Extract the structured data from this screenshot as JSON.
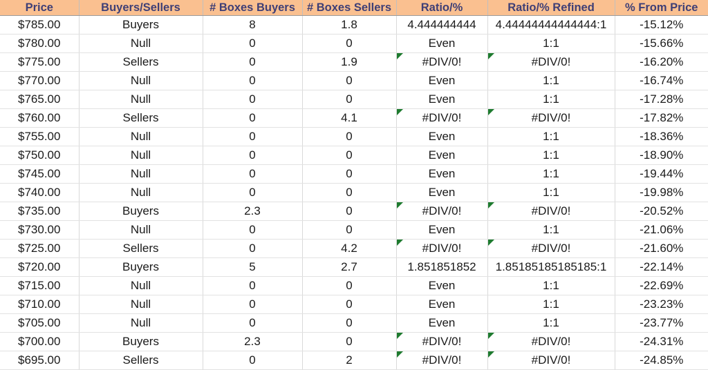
{
  "table": {
    "columns": [
      {
        "key": "price",
        "label": "Price"
      },
      {
        "key": "status",
        "label": "Buyers/Sellers"
      },
      {
        "key": "boxes_buy",
        "label": "# Boxes Buyers"
      },
      {
        "key": "boxes_sell",
        "label": "# Boxes Sellers"
      },
      {
        "key": "ratio",
        "label": "Ratio/%"
      },
      {
        "key": "ratio_ref",
        "label": "Ratio/% Refined"
      },
      {
        "key": "pct",
        "label": "% From Price"
      }
    ],
    "colors": {
      "header_bg": "#FAC090",
      "header_text": "#3F3F76",
      "buyers_bg": "#C6EFCE",
      "buyers_text": "#1E7B34",
      "sellers_bg": "#FFC7CE",
      "sellers_text": "#C00034",
      "null_bg": "#FFEB9C",
      "null_text": "#9C6500",
      "error_flag": "#1E7B2F",
      "grid_line": "#D9D9D9"
    },
    "rows": [
      {
        "price": "$785.00",
        "status": "Buyers",
        "status_kind": "buyers",
        "boxes_buy": "8",
        "boxes_sell": "1.8",
        "ratio": "4.444444444",
        "ratio_error": false,
        "ratio_ref": "4.44444444444444:1",
        "ratio_ref_error": false,
        "pct": "-15.12%"
      },
      {
        "price": "$780.00",
        "status": "Null",
        "status_kind": "null",
        "boxes_buy": "0",
        "boxes_sell": "0",
        "ratio": "Even",
        "ratio_error": false,
        "ratio_ref": "1:1",
        "ratio_ref_error": false,
        "pct": "-15.66%"
      },
      {
        "price": "$775.00",
        "status": "Sellers",
        "status_kind": "sellers",
        "boxes_buy": "0",
        "boxes_sell": "1.9",
        "ratio": "#DIV/0!",
        "ratio_error": true,
        "ratio_ref": "#DIV/0!",
        "ratio_ref_error": true,
        "pct": "-16.20%"
      },
      {
        "price": "$770.00",
        "status": "Null",
        "status_kind": "null",
        "boxes_buy": "0",
        "boxes_sell": "0",
        "ratio": "Even",
        "ratio_error": false,
        "ratio_ref": "1:1",
        "ratio_ref_error": false,
        "pct": "-16.74%"
      },
      {
        "price": "$765.00",
        "status": "Null",
        "status_kind": "null",
        "boxes_buy": "0",
        "boxes_sell": "0",
        "ratio": "Even",
        "ratio_error": false,
        "ratio_ref": "1:1",
        "ratio_ref_error": false,
        "pct": "-17.28%"
      },
      {
        "price": "$760.00",
        "status": "Sellers",
        "status_kind": "sellers",
        "boxes_buy": "0",
        "boxes_sell": "4.1",
        "ratio": "#DIV/0!",
        "ratio_error": true,
        "ratio_ref": "#DIV/0!",
        "ratio_ref_error": true,
        "pct": "-17.82%"
      },
      {
        "price": "$755.00",
        "status": "Null",
        "status_kind": "null",
        "boxes_buy": "0",
        "boxes_sell": "0",
        "ratio": "Even",
        "ratio_error": false,
        "ratio_ref": "1:1",
        "ratio_ref_error": false,
        "pct": "-18.36%"
      },
      {
        "price": "$750.00",
        "status": "Null",
        "status_kind": "null",
        "boxes_buy": "0",
        "boxes_sell": "0",
        "ratio": "Even",
        "ratio_error": false,
        "ratio_ref": "1:1",
        "ratio_ref_error": false,
        "pct": "-18.90%"
      },
      {
        "price": "$745.00",
        "status": "Null",
        "status_kind": "null",
        "boxes_buy": "0",
        "boxes_sell": "0",
        "ratio": "Even",
        "ratio_error": false,
        "ratio_ref": "1:1",
        "ratio_ref_error": false,
        "pct": "-19.44%"
      },
      {
        "price": "$740.00",
        "status": "Null",
        "status_kind": "null",
        "boxes_buy": "0",
        "boxes_sell": "0",
        "ratio": "Even",
        "ratio_error": false,
        "ratio_ref": "1:1",
        "ratio_ref_error": false,
        "pct": "-19.98%"
      },
      {
        "price": "$735.00",
        "status": "Buyers",
        "status_kind": "buyers",
        "boxes_buy": "2.3",
        "boxes_sell": "0",
        "ratio": "#DIV/0!",
        "ratio_error": true,
        "ratio_ref": "#DIV/0!",
        "ratio_ref_error": true,
        "pct": "-20.52%"
      },
      {
        "price": "$730.00",
        "status": "Null",
        "status_kind": "null",
        "boxes_buy": "0",
        "boxes_sell": "0",
        "ratio": "Even",
        "ratio_error": false,
        "ratio_ref": "1:1",
        "ratio_ref_error": false,
        "pct": "-21.06%"
      },
      {
        "price": "$725.00",
        "status": "Sellers",
        "status_kind": "sellers",
        "boxes_buy": "0",
        "boxes_sell": "4.2",
        "ratio": "#DIV/0!",
        "ratio_error": true,
        "ratio_ref": "#DIV/0!",
        "ratio_ref_error": true,
        "pct": "-21.60%"
      },
      {
        "price": "$720.00",
        "status": "Buyers",
        "status_kind": "buyers",
        "boxes_buy": "5",
        "boxes_sell": "2.7",
        "ratio": "1.851851852",
        "ratio_error": false,
        "ratio_ref": "1.85185185185185:1",
        "ratio_ref_error": false,
        "pct": "-22.14%"
      },
      {
        "price": "$715.00",
        "status": "Null",
        "status_kind": "null",
        "boxes_buy": "0",
        "boxes_sell": "0",
        "ratio": "Even",
        "ratio_error": false,
        "ratio_ref": "1:1",
        "ratio_ref_error": false,
        "pct": "-22.69%"
      },
      {
        "price": "$710.00",
        "status": "Null",
        "status_kind": "null",
        "boxes_buy": "0",
        "boxes_sell": "0",
        "ratio": "Even",
        "ratio_error": false,
        "ratio_ref": "1:1",
        "ratio_ref_error": false,
        "pct": "-23.23%"
      },
      {
        "price": "$705.00",
        "status": "Null",
        "status_kind": "null",
        "boxes_buy": "0",
        "boxes_sell": "0",
        "ratio": "Even",
        "ratio_error": false,
        "ratio_ref": "1:1",
        "ratio_ref_error": false,
        "pct": "-23.77%"
      },
      {
        "price": "$700.00",
        "status": "Buyers",
        "status_kind": "buyers",
        "boxes_buy": "2.3",
        "boxes_sell": "0",
        "ratio": "#DIV/0!",
        "ratio_error": true,
        "ratio_ref": "#DIV/0!",
        "ratio_ref_error": true,
        "pct": "-24.31%"
      },
      {
        "price": "$695.00",
        "status": "Sellers",
        "status_kind": "sellers",
        "boxes_buy": "0",
        "boxes_sell": "2",
        "ratio": "#DIV/0!",
        "ratio_error": true,
        "ratio_ref": "#DIV/0!",
        "ratio_ref_error": true,
        "pct": "-24.85%"
      }
    ]
  }
}
